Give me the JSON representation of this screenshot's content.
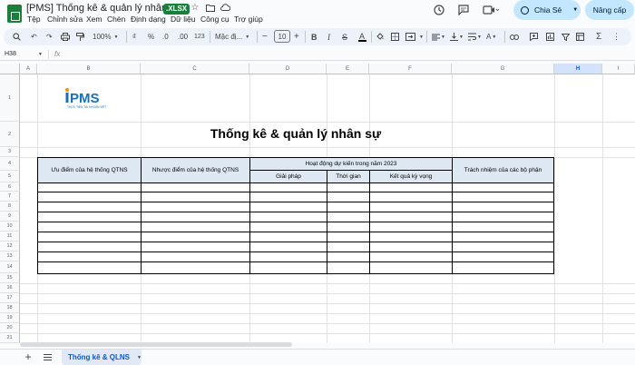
{
  "header": {
    "title": "[PMS] Thống kê & quản lý nhân sự",
    "ext_badge": ".XLSX",
    "share_label": "Chia Sẻ",
    "upgrade_label": "Nâng cấp",
    "menus": [
      "Tệp",
      "Chỉnh sửa",
      "Xem",
      "Chèn",
      "Định dạng",
      "Dữ liệu",
      "Công cụ",
      "Trợ giúp"
    ]
  },
  "toolbar": {
    "zoom": "100%",
    "currency": "₫",
    "percent": "%",
    "dec_dec": ".0",
    "dec_inc": ".00",
    "num_format": "123",
    "font": "Mặc đị...",
    "font_size": "10"
  },
  "formula": {
    "cell_ref": "H38",
    "fx": "fx"
  },
  "columns": [
    "A",
    "B",
    "C",
    "D",
    "E",
    "F",
    "G",
    "H",
    "I"
  ],
  "rows": [
    "1",
    "2",
    "3",
    "4",
    "5",
    "6",
    "7",
    "8",
    "9",
    "10",
    "11",
    "12",
    "13",
    "14",
    "15",
    "16",
    "17",
    "18",
    "19",
    "20",
    "21"
  ],
  "logo": {
    "name": "iPMS",
    "tagline": "THỰC TIỄN TÀI KHOẢN VIỆT"
  },
  "sheet": {
    "title": "Thống kê & quản lý nhân sự",
    "headers": {
      "advantages": "Ưu điểm của hệ thống QTNS",
      "disadvantages": "Nhược điểm của hệ thống QTNS",
      "planned": "Hoạt động dự kiến trong năm 2023",
      "solution": "Giải pháp",
      "time": "Thời gian",
      "result": "Kết quả kỳ vọng",
      "responsibility": "Trách nhiệm của các bộ phận"
    }
  },
  "tabs": {
    "active": "Thống kê & QLNS"
  },
  "colors": {
    "accent": "#0b57d0",
    "header_fill": "#dde8f3",
    "brand": "#1a6fb5"
  }
}
